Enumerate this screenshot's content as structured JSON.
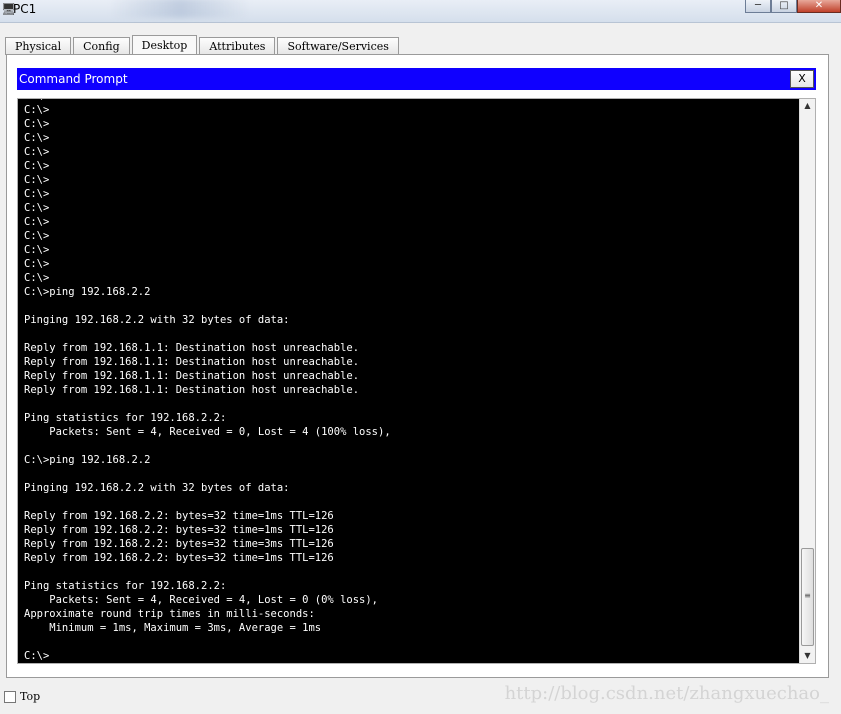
{
  "window": {
    "title": "PC1",
    "controls": {
      "minimize": "─",
      "maximize": "□",
      "close": "✕"
    }
  },
  "tabs": [
    {
      "label": "Physical",
      "active": false
    },
    {
      "label": "Config",
      "active": false
    },
    {
      "label": "Desktop",
      "active": true
    },
    {
      "label": "Attributes",
      "active": false
    },
    {
      "label": "Software/Services",
      "active": false
    }
  ],
  "command_prompt": {
    "title": "Command Prompt",
    "close_label": "X",
    "lines": [
      "C:\\>",
      "C:\\>",
      "C:\\>",
      "C:\\>",
      "C:\\>",
      "C:\\>",
      "C:\\>",
      "C:\\>",
      "C:\\>",
      "C:\\>",
      "C:\\>",
      "C:\\>",
      "C:\\>",
      "C:\\>",
      "C:\\>ping 192.168.2.2",
      "",
      "Pinging 192.168.2.2 with 32 bytes of data:",
      "",
      "Reply from 192.168.1.1: Destination host unreachable.",
      "Reply from 192.168.1.1: Destination host unreachable.",
      "Reply from 192.168.1.1: Destination host unreachable.",
      "Reply from 192.168.1.1: Destination host unreachable.",
      "",
      "Ping statistics for 192.168.2.2:",
      "    Packets: Sent = 4, Received = 0, Lost = 4 (100% loss),",
      "",
      "C:\\>ping 192.168.2.2",
      "",
      "Pinging 192.168.2.2 with 32 bytes of data:",
      "",
      "Reply from 192.168.2.2: bytes=32 time=1ms TTL=126",
      "Reply from 192.168.2.2: bytes=32 time=1ms TTL=126",
      "Reply from 192.168.2.2: bytes=32 time=3ms TTL=126",
      "Reply from 192.168.2.2: bytes=32 time=1ms TTL=126",
      "",
      "Ping statistics for 192.168.2.2:",
      "    Packets: Sent = 4, Received = 4, Lost = 0 (0% loss),",
      "Approximate round trip times in milli-seconds:",
      "    Minimum = 1ms, Maximum = 3ms, Average = 1ms",
      "",
      "C:\\>"
    ],
    "scrollbar": {
      "up_icon": "▲",
      "down_icon": "▼",
      "grip_icon": "≡"
    }
  },
  "footer": {
    "top_checkbox_label": "Top",
    "top_checked": false,
    "watermark": "http://blog.csdn.net/zhangxuechao_"
  },
  "colors": {
    "cmd_titlebar": "#0f00ff",
    "terminal_bg": "#000000",
    "terminal_fg": "#ffffff"
  }
}
